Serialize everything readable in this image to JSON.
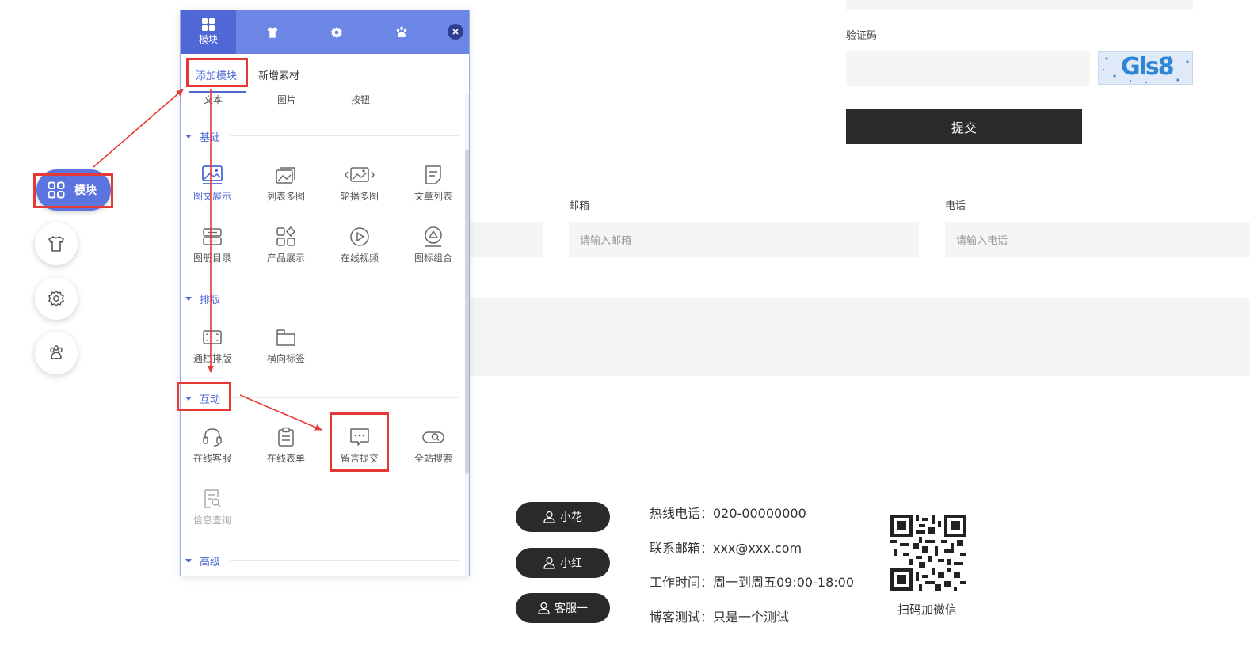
{
  "form": {
    "captcha_label": "验证码",
    "captcha_text": "Gls8",
    "submit_label": "提交",
    "email_label": "邮箱",
    "email_placeholder": "请输入邮箱",
    "phone_label": "电话",
    "phone_placeholder": "请输入电话"
  },
  "nav": {
    "module_label": "模块"
  },
  "panel": {
    "tabs": [
      {
        "label": "模块",
        "icon": "grid-icon"
      },
      {
        "icon": "shirt-icon"
      },
      {
        "icon": "gear-icon"
      },
      {
        "icon": "paw-icon"
      }
    ],
    "subtabs": [
      "添加模块",
      "新增素材"
    ],
    "cutoff_items": [
      "文本",
      "图片",
      "按钮"
    ],
    "sections": [
      {
        "title": "基础",
        "items": [
          "图文展示",
          "列表多图",
          "轮播多图",
          "文章列表",
          "图册目录",
          "产品展示",
          "在线视频",
          "图标组合"
        ]
      },
      {
        "title": "排版",
        "items": [
          "通栏排版",
          "横向标签"
        ]
      },
      {
        "title": "互动",
        "items": [
          "在线客服",
          "在线表单",
          "留言提交",
          "全站搜索",
          "信息查询"
        ]
      },
      {
        "title": "高级",
        "items": []
      }
    ]
  },
  "footer": {
    "contacts": [
      "小花",
      "小红",
      "客服一"
    ],
    "info": [
      "热线电话：020-00000000",
      "联系邮箱：xxx@xxx.com",
      "工作时间：周一到周五09:00-18:00",
      "博客测试：只是一个测试"
    ],
    "qr_label": "扫码加微信"
  },
  "colors": {
    "accent": "#4f68d6",
    "header": "#6c86e6",
    "annotation": "#e53935",
    "dark_button": "#2a2a2a"
  }
}
